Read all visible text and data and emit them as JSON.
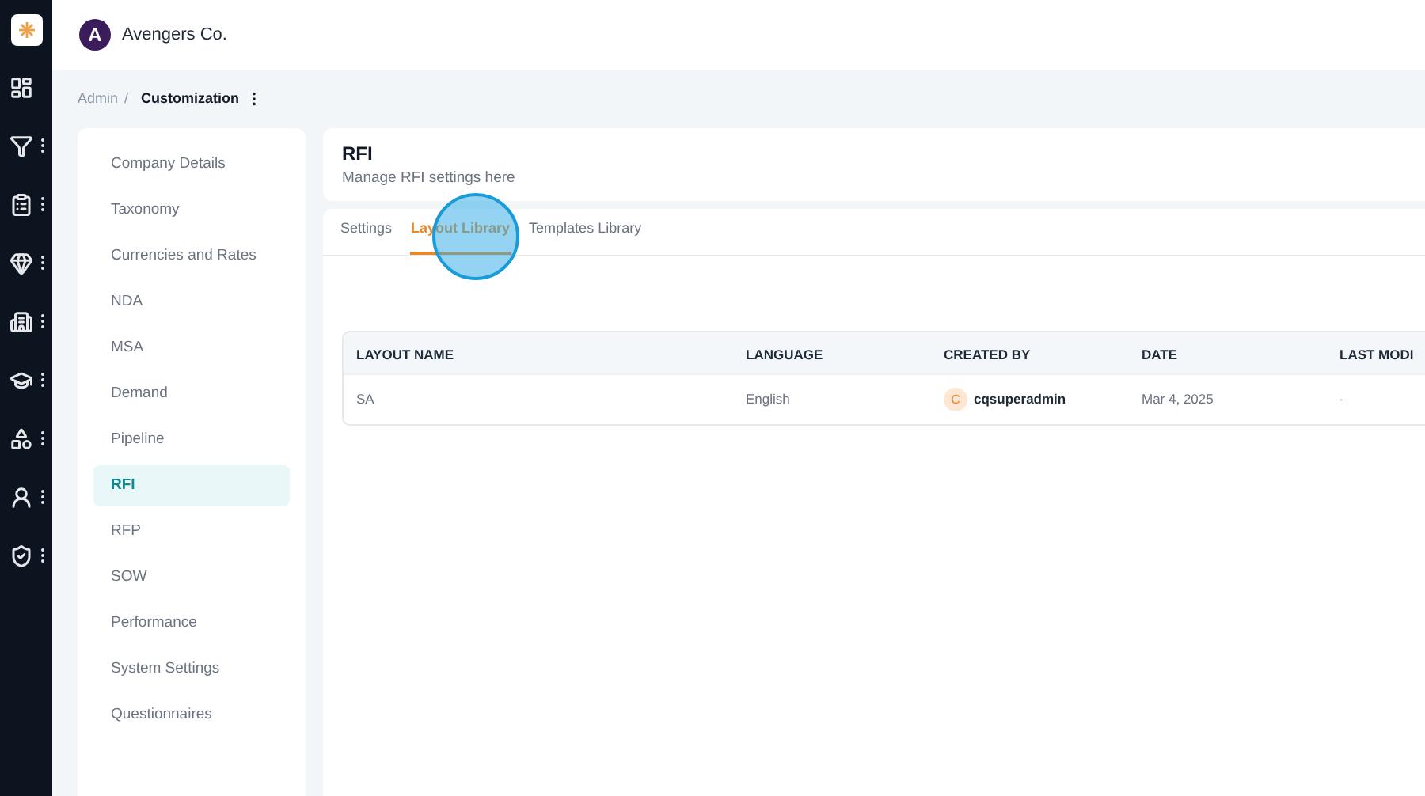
{
  "header": {
    "company": "Avengers Co.",
    "logo_letter": "A"
  },
  "rail": [
    {
      "kind": "dashboard",
      "menu": false
    },
    {
      "kind": "filter",
      "menu": true
    },
    {
      "kind": "clipboard",
      "menu": true
    },
    {
      "kind": "gem",
      "menu": true
    },
    {
      "kind": "building",
      "menu": true
    },
    {
      "kind": "cap",
      "menu": true
    },
    {
      "kind": "shapes",
      "menu": true
    },
    {
      "kind": "user",
      "menu": true
    },
    {
      "kind": "shield",
      "menu": true
    }
  ],
  "breadcrumb": {
    "parent": "Admin",
    "separator": "/",
    "current": "Customization"
  },
  "sidebar": {
    "items": [
      {
        "label": "Company Details",
        "selected": false
      },
      {
        "label": "Taxonomy",
        "selected": false
      },
      {
        "label": "Currencies and Rates",
        "selected": false
      },
      {
        "label": "NDA",
        "selected": false
      },
      {
        "label": "MSA",
        "selected": false
      },
      {
        "label": "Demand",
        "selected": false
      },
      {
        "label": "Pipeline",
        "selected": false
      },
      {
        "label": "RFI",
        "selected": true
      },
      {
        "label": "RFP",
        "selected": false
      },
      {
        "label": "SOW",
        "selected": false
      },
      {
        "label": "Performance",
        "selected": false
      },
      {
        "label": "System Settings",
        "selected": false
      },
      {
        "label": "Questionnaires",
        "selected": false
      }
    ]
  },
  "section": {
    "title": "RFI",
    "subtitle": "Manage RFI settings here"
  },
  "tabs": [
    {
      "label": "Settings",
      "selected": false
    },
    {
      "label": "Layout Library",
      "selected": true
    },
    {
      "label": "Templates Library",
      "selected": false
    }
  ],
  "table": {
    "columns": [
      "LAYOUT NAME",
      "LANGUAGE",
      "CREATED BY",
      "DATE",
      "LAST MODI"
    ],
    "rows": [
      {
        "name": "SA",
        "language": "English",
        "creator_initial": "C",
        "creator": "cqsuperadmin",
        "date": "Mar 4, 2025",
        "last_modified": "-"
      }
    ]
  }
}
